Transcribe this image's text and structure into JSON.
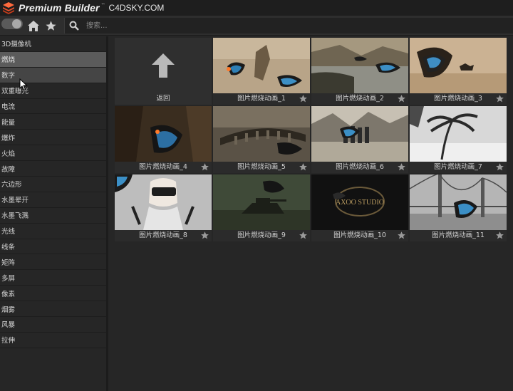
{
  "titlebar": {
    "app_name": "Premium Builder",
    "superscript": "™",
    "site": "C4DSKY.COM"
  },
  "toolbar": {
    "toggle_state": "off",
    "home_icon": "home-icon",
    "favorites_icon": "star-icon",
    "search_placeholder": "搜索..."
  },
  "sidebar": {
    "items": [
      {
        "label": "3D摄像机"
      },
      {
        "label": "燃烧"
      },
      {
        "label": "数字"
      },
      {
        "label": "双重曝光"
      },
      {
        "label": "电流"
      },
      {
        "label": "能量"
      },
      {
        "label": "爆炸"
      },
      {
        "label": "火焰"
      },
      {
        "label": "故障"
      },
      {
        "label": "六边形"
      },
      {
        "label": "水墨晕开"
      },
      {
        "label": "水墨飞溅"
      },
      {
        "label": "光线"
      },
      {
        "label": "线条"
      },
      {
        "label": "矩阵"
      },
      {
        "label": "多屏"
      },
      {
        "label": "像素"
      },
      {
        "label": "烟雾"
      },
      {
        "label": "风暴"
      },
      {
        "label": "拉伸"
      }
    ],
    "active": "燃烧",
    "hovered": "数字"
  },
  "grid": {
    "back_label": "返回",
    "items": [
      {
        "label": "图片燃烧动画_1"
      },
      {
        "label": "图片燃烧动画_2"
      },
      {
        "label": "图片燃烧动画_3"
      },
      {
        "label": "图片燃烧动画_4"
      },
      {
        "label": "图片燃烧动画_5"
      },
      {
        "label": "图片燃烧动画_6"
      },
      {
        "label": "图片燃烧动画_7"
      },
      {
        "label": "图片燃烧动画_8"
      },
      {
        "label": "图片燃烧动画_9"
      },
      {
        "label": "图片燃烧动画_10"
      },
      {
        "label": "图片燃烧动画_11"
      }
    ]
  },
  "colors": {
    "accent": "#e8502a",
    "background": "#262626",
    "active_item": "#5b5b5b"
  }
}
